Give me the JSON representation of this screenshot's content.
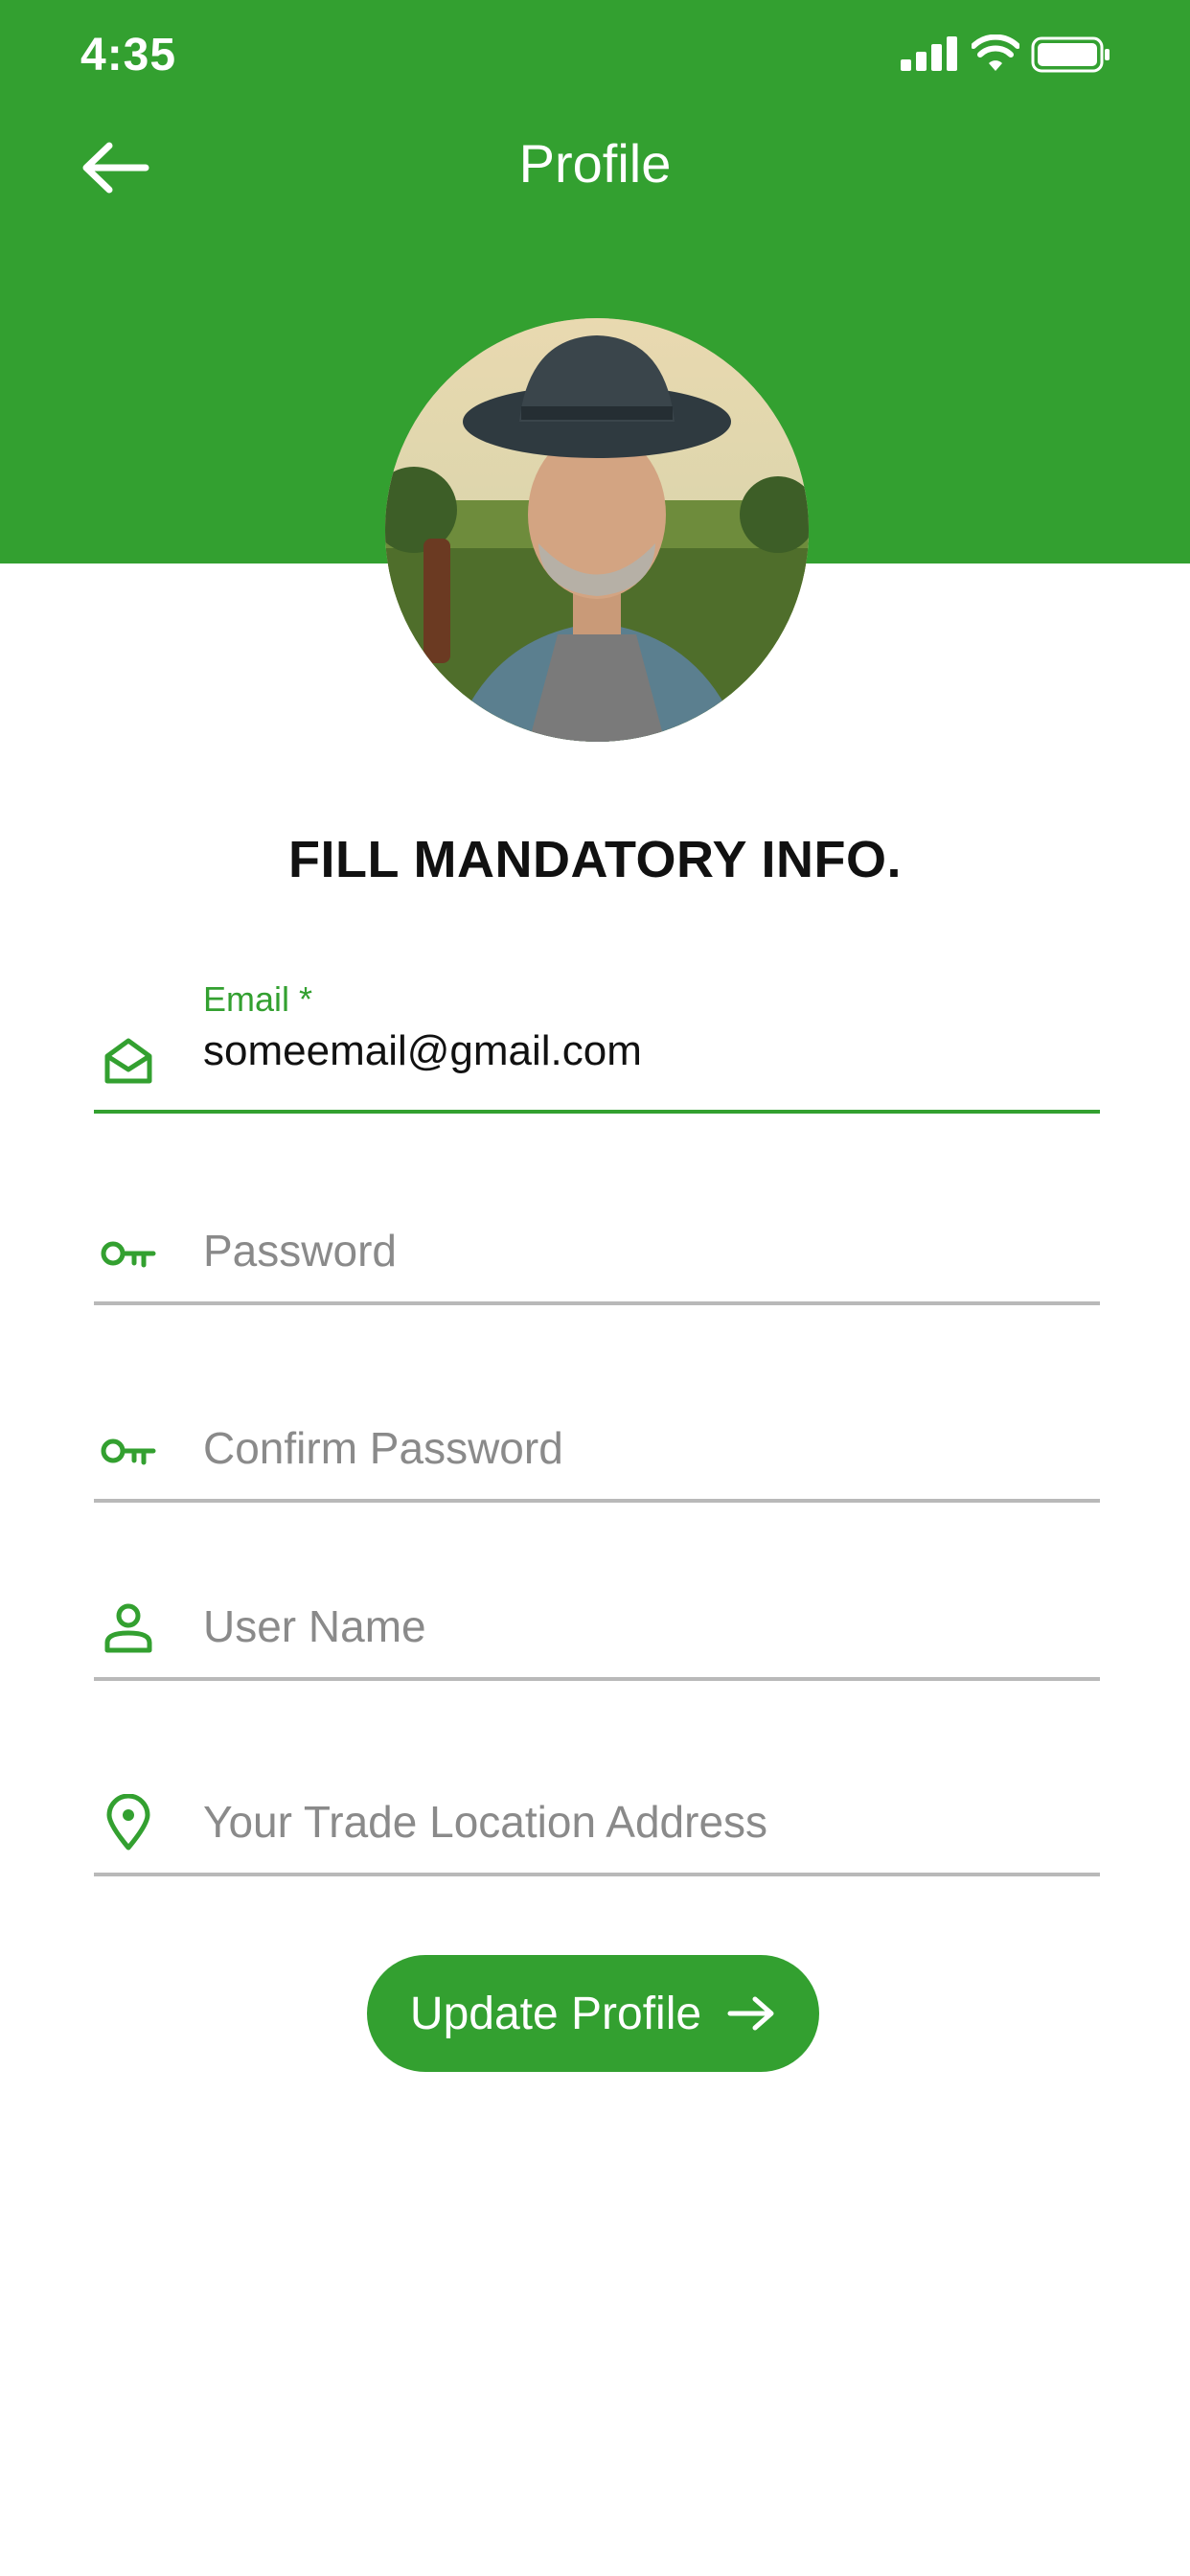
{
  "status_bar": {
    "time": "4:35"
  },
  "header": {
    "title": "Profile"
  },
  "profile": {
    "avatar": "farmer-photo"
  },
  "form": {
    "heading": "FILL MANDATORY INFO.",
    "email": {
      "label": "Email *",
      "value": "someemail@gmail.com",
      "icon": "envelope-icon"
    },
    "password": {
      "placeholder": "Password",
      "icon": "key-icon"
    },
    "confirm_password": {
      "placeholder": "Confirm Password",
      "icon": "key-icon"
    },
    "user_name": {
      "placeholder": "User Name",
      "icon": "user-icon"
    },
    "trade_location": {
      "placeholder": "Your Trade Location Address",
      "icon": "location-pin-icon"
    }
  },
  "update_button": {
    "label": "Update Profile",
    "icon": "arrow-right-icon"
  },
  "colors": {
    "brand": "#33a030",
    "input_border": "#b9b9b9",
    "placeholder": "#8a8a8a"
  }
}
